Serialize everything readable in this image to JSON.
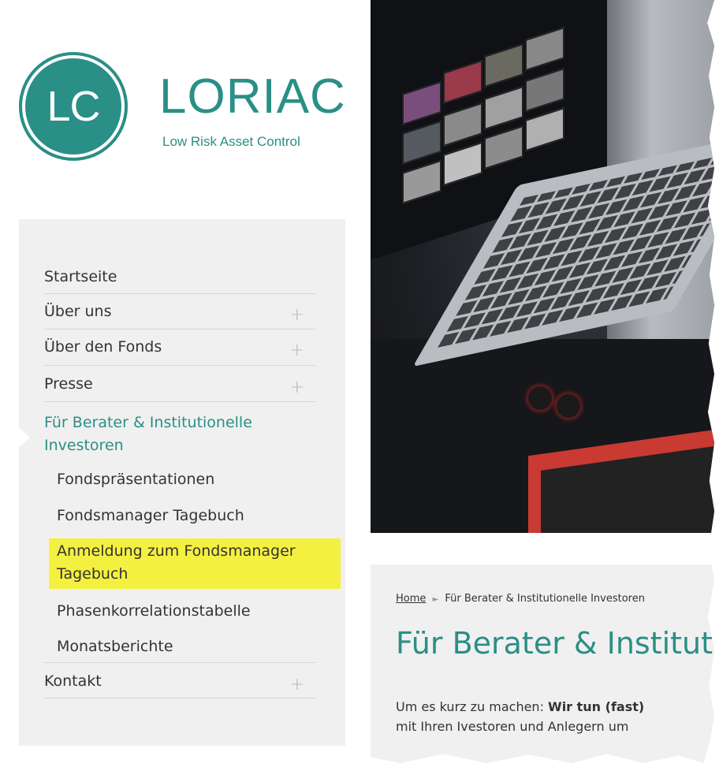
{
  "brand": {
    "logo_initials": "LC",
    "name": "LORIAC",
    "tagline": "Low Risk Asset Control"
  },
  "nav": {
    "items": [
      {
        "label": "Startseite"
      },
      {
        "label": "Über uns",
        "expand": "+"
      },
      {
        "label": "Über den Fonds",
        "expand": "+"
      },
      {
        "label": "Presse",
        "expand": "+"
      },
      {
        "label": "Für Berater & Institutionelle Investoren"
      },
      {
        "label": "Kontakt",
        "expand": "+"
      }
    ],
    "sub_items": [
      {
        "label": "Fondspräsentationen"
      },
      {
        "label": "Fondsmanager Tagebuch"
      },
      {
        "label": "Anmeldung zum Fondsmanager Tagebuch"
      },
      {
        "label": "Phasenkorrelationstabelle"
      },
      {
        "label": "Monatsberichte"
      }
    ]
  },
  "content": {
    "breadcrumb_home": "Home",
    "breadcrumb_sep": "►",
    "breadcrumb_current": "Für Berater & Institutionelle Investoren",
    "title": "Für Berater & Institutionelle Investoren",
    "intro_start": "Um es kurz zu machen: ",
    "intro_bold": "Wir tun (fast)",
    "intro_line2": "mit Ihren Ivestoren und Anlegern um"
  },
  "colors": {
    "accent": "#2a8f86",
    "highlight": "#f4f040",
    "sidebar_bg": "#f0f0f0"
  }
}
